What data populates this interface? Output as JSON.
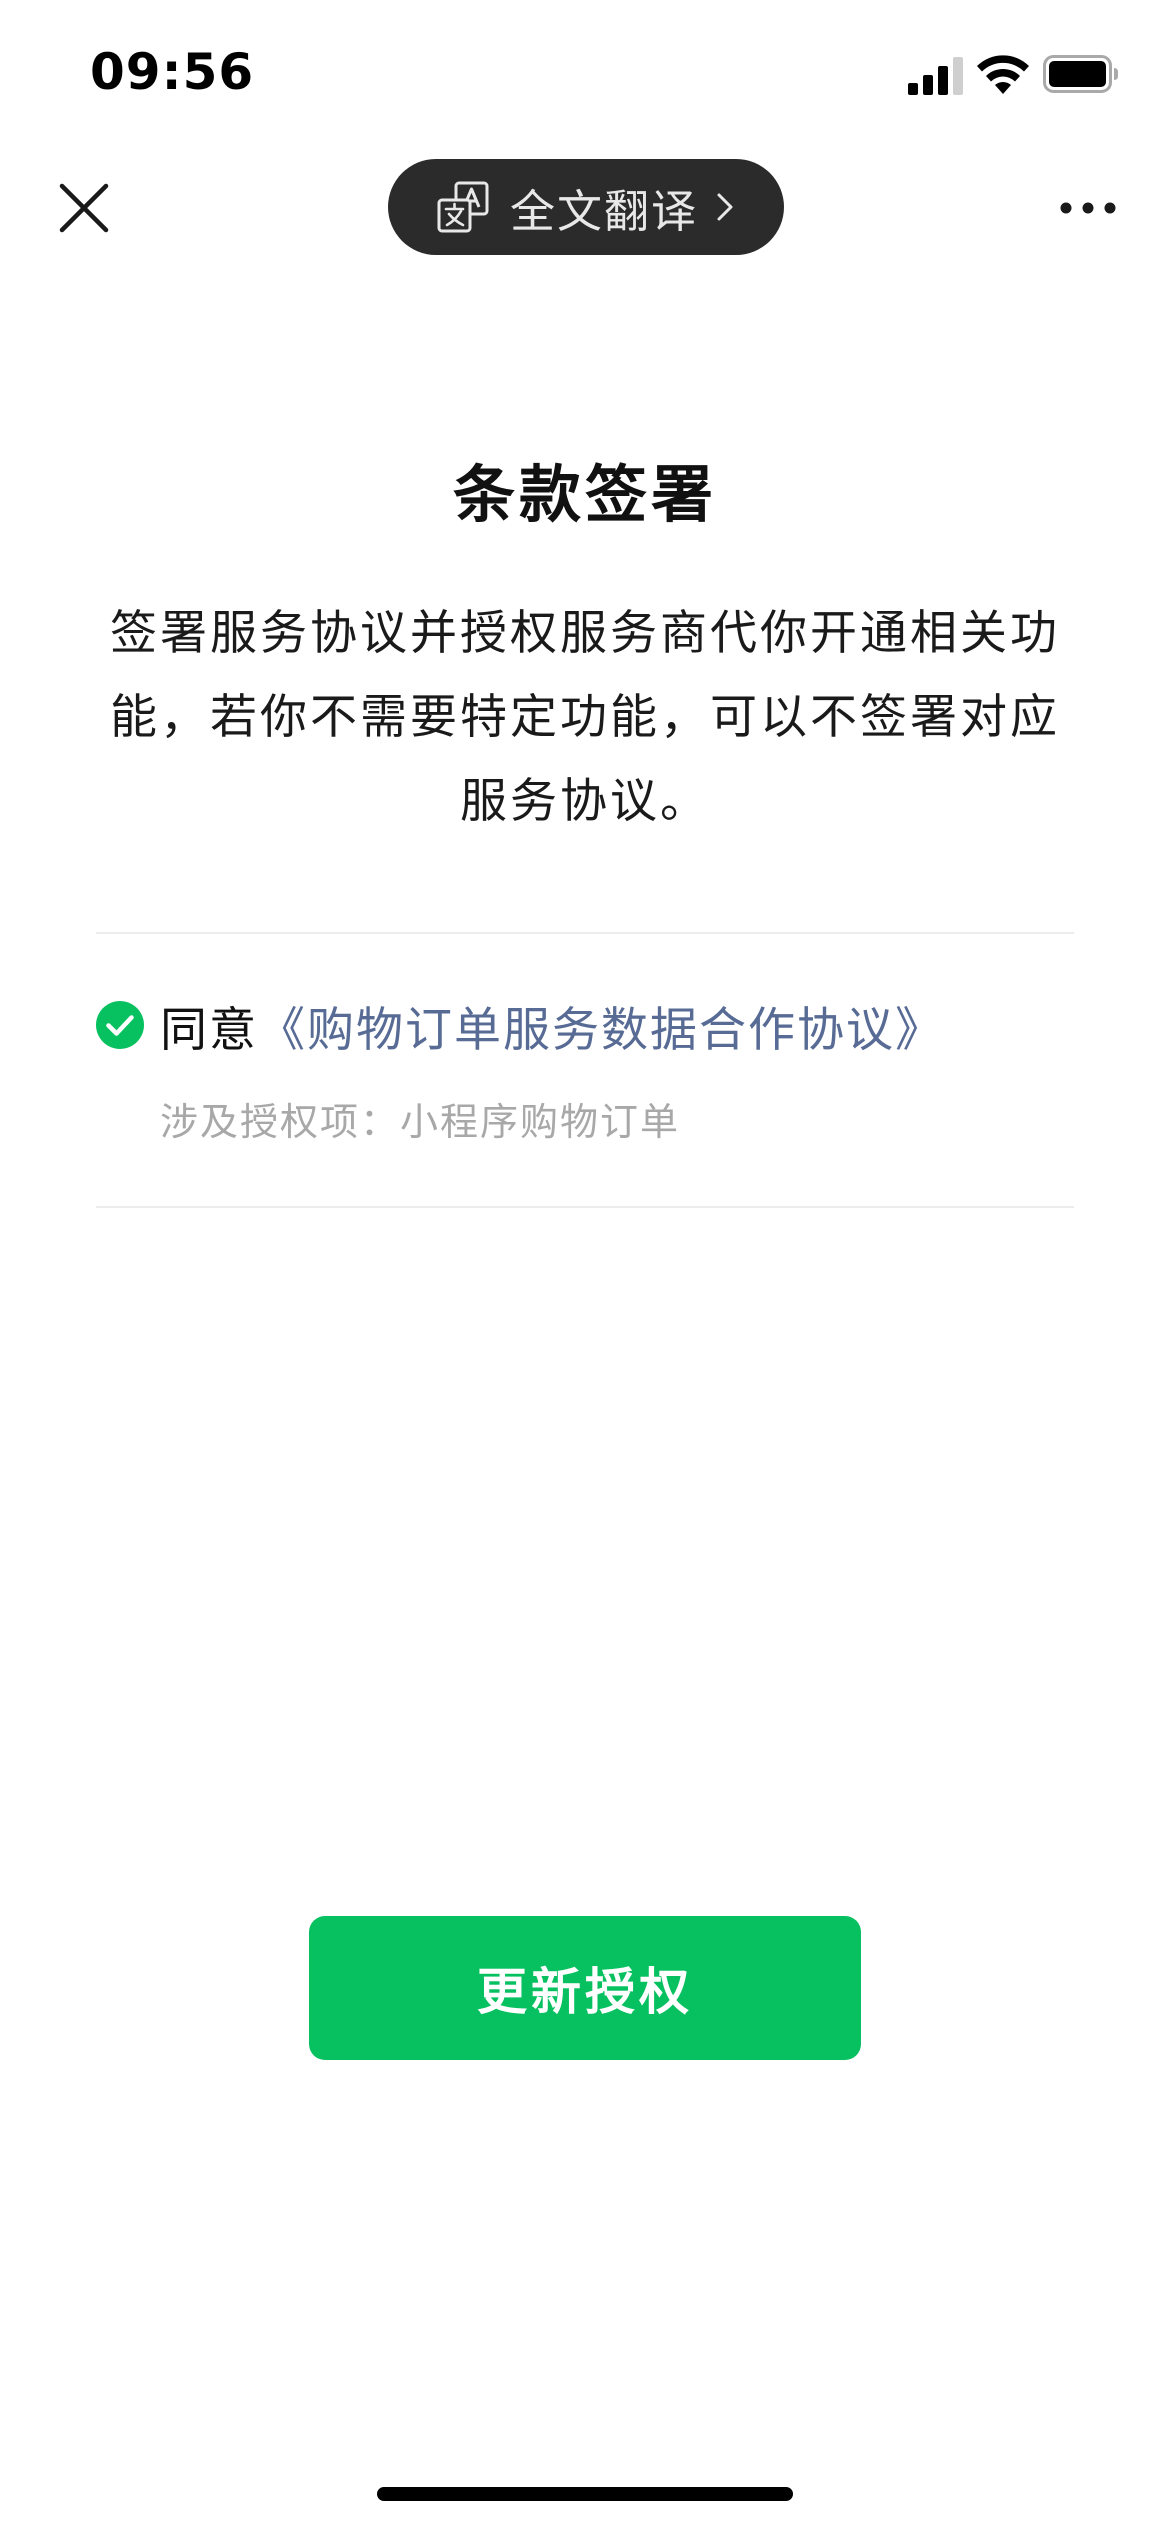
{
  "status_bar": {
    "time": "09:56"
  },
  "nav": {
    "translate_label": "全文翻译"
  },
  "content": {
    "title": "条款签署",
    "description": "签署服务协议并授权服务商代你开通相关功能，若你不需要特定功能，可以不签署对应服务协议。",
    "agreement": {
      "checked": true,
      "agree_label": "同意",
      "link_text": "《购物订单服务数据合作协议》",
      "scope_text": "涉及授权项：小程序购物订单"
    }
  },
  "actions": {
    "primary_label": "更新授权"
  },
  "colors": {
    "primary_green": "#07c160",
    "link_blue": "#576b95",
    "pill_background": "#2b2b2b",
    "secondary_text": "#a8a8a8"
  },
  "icons": {
    "close": "close-icon",
    "translate": "translate-icon",
    "chevron": "chevron-right-icon",
    "more": "more-icon",
    "check": "check-circle-icon",
    "signal": "signal-icon",
    "wifi": "wifi-icon",
    "battery": "battery-icon"
  }
}
